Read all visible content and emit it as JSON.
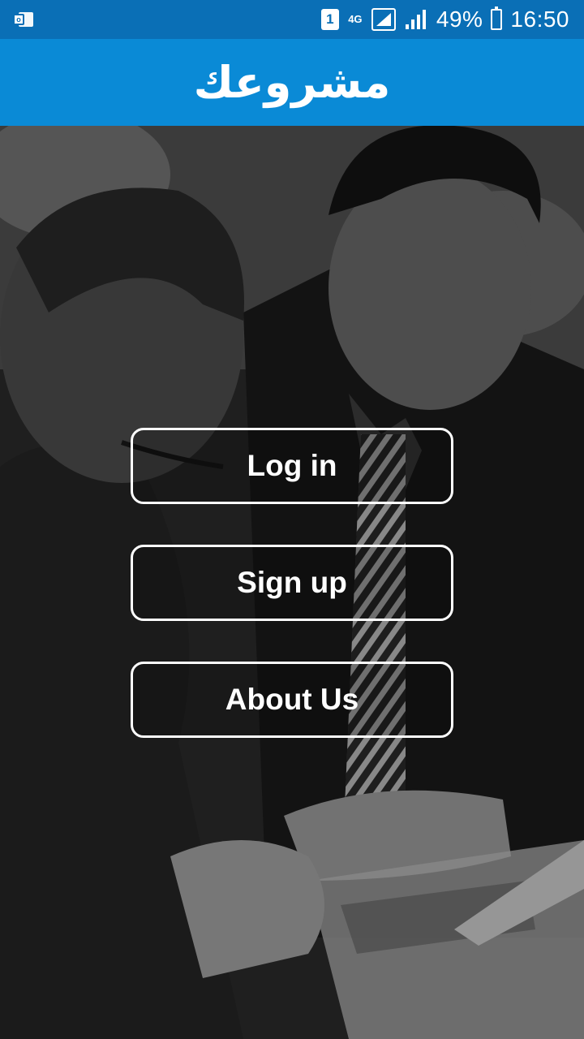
{
  "status_bar": {
    "notification_icon": "outlook-icon",
    "sim_label": "1",
    "network_label": "4G",
    "battery_percent": "49%",
    "time": "16:50"
  },
  "app_bar": {
    "title": "مشروعك",
    "color": "#0a8ad6"
  },
  "hero": {
    "image": "business-meeting-photo"
  },
  "buttons": {
    "login": "Log in",
    "signup": "Sign up",
    "about": "About Us"
  }
}
